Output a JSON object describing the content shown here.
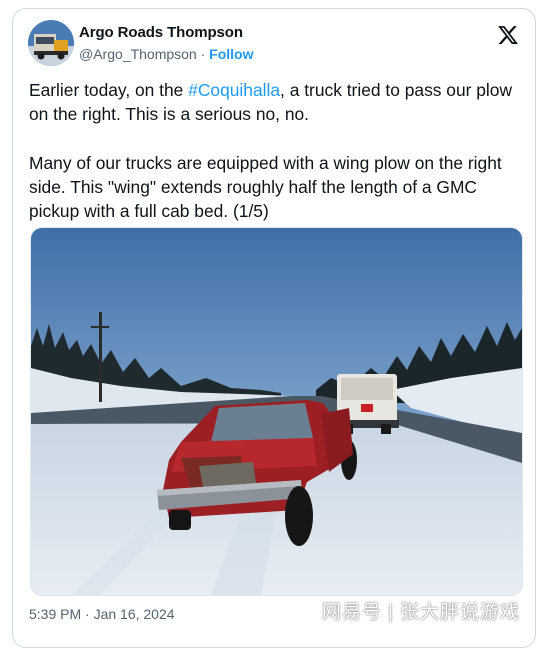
{
  "tweet": {
    "author_name": "Argo Roads Thompson",
    "handle": "@Argo_Thompson",
    "separator": "·",
    "follow_label": "Follow",
    "text_before_hashtag": "Earlier today, on the ",
    "hashtag": "#Coquihalla",
    "text_after_hashtag": ", a truck tried to pass our plow on the right. This is a serious no, no.",
    "paragraph2": "Many of our trucks are equipped with a wing plow on the right side. This \"wing\" extends roughly half the length of a GMC pickup with a full cab bed.  (1/5)",
    "timestamp": "5:39 PM · Jan 16, 2024"
  },
  "icons": {
    "platform_logo": "x-logo-icon"
  },
  "colors": {
    "link": "#1d9bf0",
    "secondary_text": "#536471",
    "border": "#cfd9de"
  },
  "watermark": {
    "left": "网易号",
    "separator": "|",
    "right": "张大胖说游戏"
  }
}
